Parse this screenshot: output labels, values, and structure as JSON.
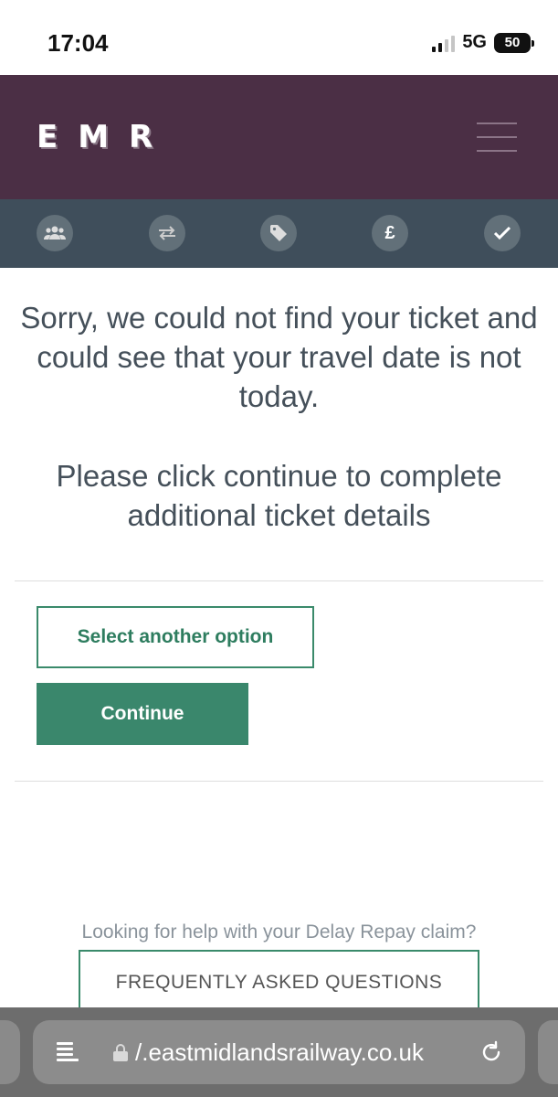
{
  "status_bar": {
    "time": "17:04",
    "network": "5G",
    "battery": "50"
  },
  "header": {
    "logo": "EMR",
    "menu_icon": "hamburger-menu-icon",
    "background": "#4b2f45"
  },
  "steps": [
    {
      "icon": "group-icon"
    },
    {
      "icon": "swap-arrows-icon"
    },
    {
      "icon": "tag-icon"
    },
    {
      "icon": "pound-icon",
      "glyph": "£"
    },
    {
      "icon": "check-icon"
    }
  ],
  "main": {
    "message_primary": "Sorry, we could not find your ticket and could see that your travel date is not today.",
    "message_secondary": "Please click continue to complete additional ticket details",
    "select_option_label": "Select another option",
    "continue_label": "Continue",
    "accent_color": "#3a876c"
  },
  "help": {
    "text": "Looking for help with your Delay Repay claim?",
    "faq_label": "FREQUENTLY ASKED QUESTIONS"
  },
  "browser": {
    "url": "/.eastmidlandsrailway.co.uk"
  }
}
